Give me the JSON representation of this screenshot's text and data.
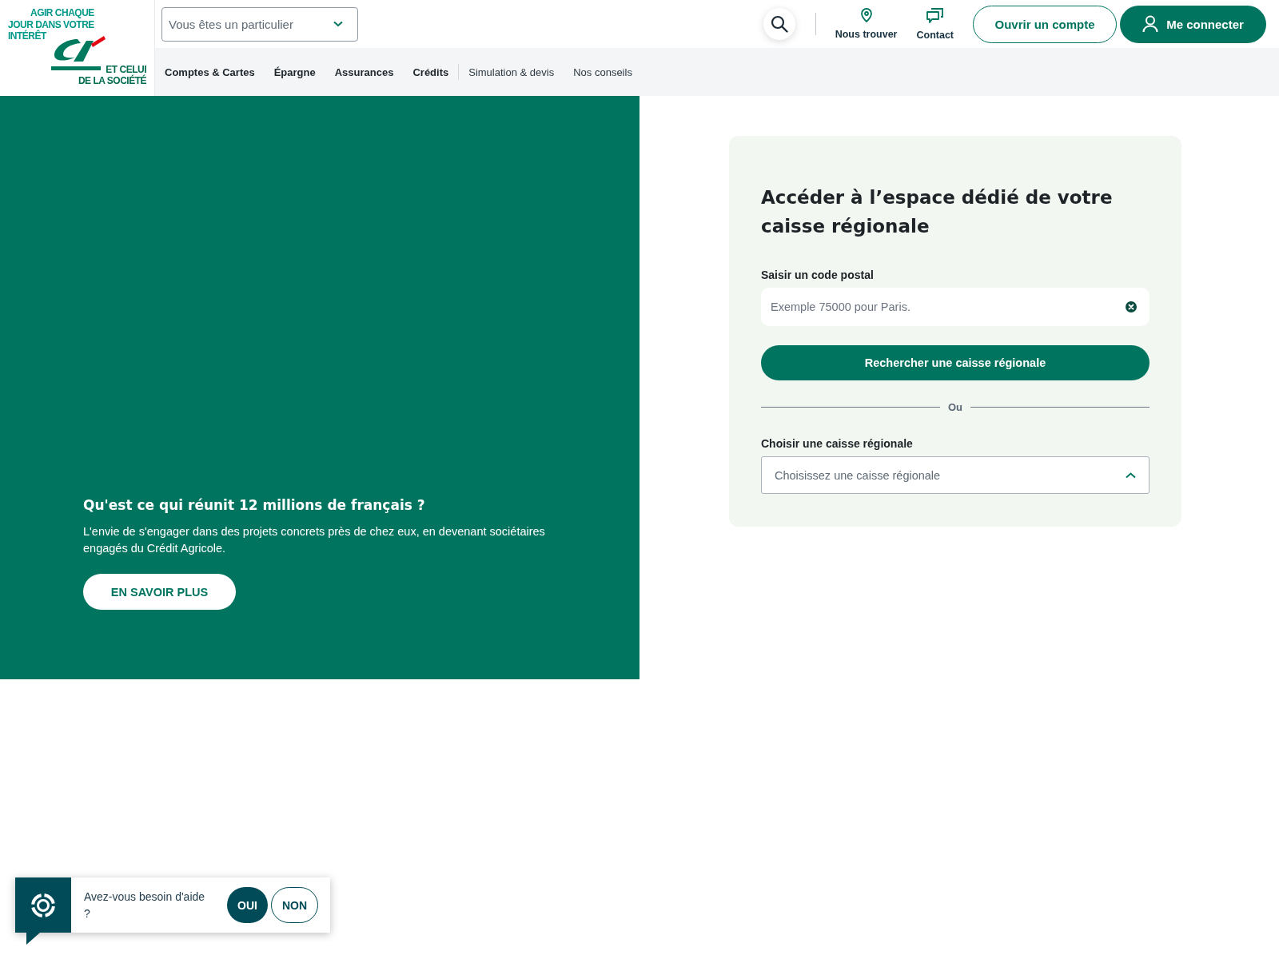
{
  "header": {
    "logo": {
      "tagline_top": [
        "AGIR CHAQUE",
        "JOUR DANS VOTRE",
        "INTÉRÊT"
      ],
      "tagline_bottom": [
        "ET CELUI",
        "DE LA SOCIÉTÉ"
      ]
    },
    "profile_select": {
      "value": "Vous êtes un particulier"
    },
    "quick_links": [
      {
        "label": "Nous trouver",
        "kind": "pin"
      },
      {
        "label": "Contact",
        "kind": "chat"
      }
    ],
    "open_account_button": "Ouvrir un compte",
    "login_button": "Me connecter",
    "nav": {
      "primary": [
        "Comptes & Cartes",
        "Épargne",
        "Assurances",
        "Crédits"
      ],
      "secondary": [
        "Simulation & devis",
        "Nos conseils"
      ]
    }
  },
  "hero": {
    "title": "Qu'est ce qui réunit 12 millions de français ?",
    "text": "L'envie de s'engager dans des projets concrets près de chez eux, en devenant sociétaires engagés du Crédit Agricole.",
    "button": "EN SAVOIR PLUS"
  },
  "regional_card": {
    "title": "Accéder à l’espace dédié de votre caisse régionale",
    "postal_label": "Saisir un code postal",
    "postal_field": {
      "placeholder": "Exemple 75000 pour Paris."
    },
    "search_button": "Rechercher une caisse régionale",
    "separator": "Ou",
    "select_label": "Choisir une caisse régionale",
    "select": {
      "placeholder": "Choisissez une caisse régionale",
      "expanded": true
    }
  },
  "help_widget": {
    "text": "Avez-vous besoin d'aide ?",
    "buttons": [
      {
        "label": "OUI",
        "kind": "filled"
      },
      {
        "label": "NON",
        "kind": "outline"
      }
    ]
  }
}
